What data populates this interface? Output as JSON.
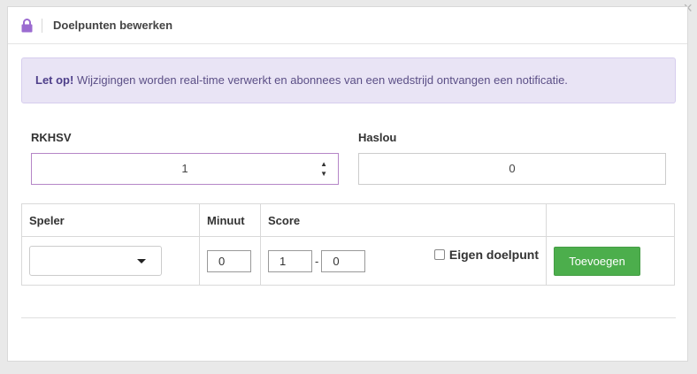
{
  "window": {
    "close_glyph": "×"
  },
  "modal": {
    "title": "Doelpunten bewerken",
    "icon": "lock-icon",
    "accent_color": "#9b6bd0"
  },
  "alert": {
    "strong": "Let op!",
    "text": " Wijzigingen worden real-time verwerkt en abonnees van een wedstrijd ontvangen een notificatie.",
    "background": "#e9e4f5"
  },
  "teams": {
    "home": {
      "name": "RKHSV",
      "score": "1"
    },
    "away": {
      "name": "Haslou",
      "score": "0"
    }
  },
  "table": {
    "headers": {
      "player": "Speler",
      "minute": "Minuut",
      "score": "Score",
      "action": ""
    },
    "row": {
      "player_selected": "",
      "minute": "0",
      "score_home": "1",
      "score_sep": "-",
      "score_away": "0",
      "own_goal_label": "Eigen doelpunt",
      "own_goal_checked": false,
      "add_button": "Toevoegen",
      "add_button_color": "#4cae4c"
    }
  }
}
